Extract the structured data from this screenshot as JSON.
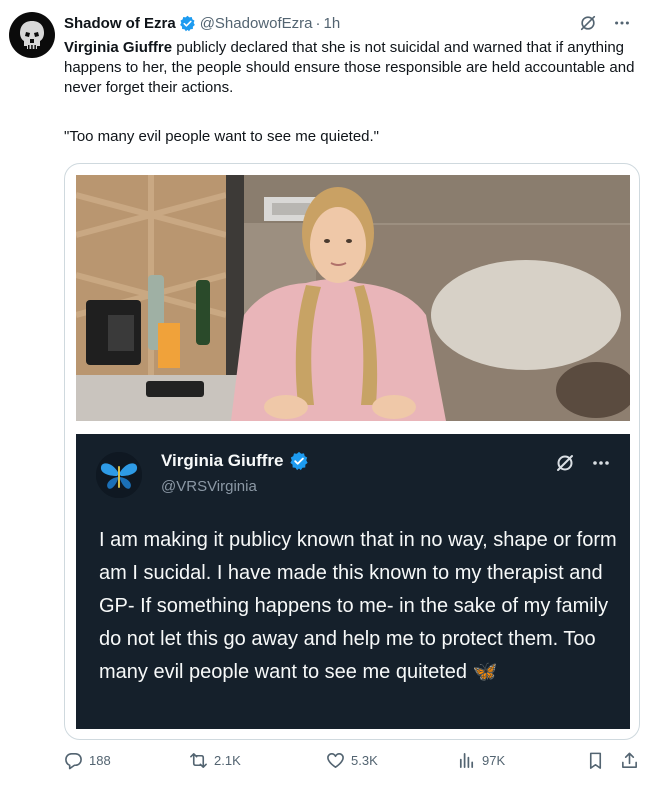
{
  "post": {
    "author_name": "Shadow of Ezra",
    "handle": "@ShadowofEzra",
    "separator": "·",
    "time": "1h",
    "text_bold": "Virginia Giuffre",
    "text_rest": " publicly declared that she is not suicidal and warned that if anything happens to her, the people should ensure those responsible are held accountable and never forget their actions.",
    "quote": "\"Too many evil people want to see me quieted.\""
  },
  "embedded_post": {
    "author_name": "Virginia Giuffre",
    "handle": "@VRSVirginia",
    "text": "I am making it publicy known that in no way, shape or form am I sucidal. I have made this known to my therapist and GP- If something happens to me- in the sake of my family do not let this go away and help me to protect them. Too many evil people want to see me quiteted",
    "emoji": "🦋"
  },
  "actions": {
    "replies": "188",
    "reposts": "2.1K",
    "likes": "5.3K",
    "views": "97K"
  },
  "icons": {
    "avatar": "skull-icon",
    "verified": "verified-badge-icon",
    "grok": "grok-icon",
    "more": "more-icon",
    "reply": "reply-icon",
    "repost": "repost-icon",
    "like": "heart-icon",
    "views": "views-icon",
    "bookmark": "bookmark-icon",
    "share": "share-icon"
  },
  "colors": {
    "accent": "#1d9bf0",
    "text": "#0f1419",
    "muted": "#536471",
    "embedded_bg": "#15202b",
    "butterfly": "#2f8fe8"
  }
}
